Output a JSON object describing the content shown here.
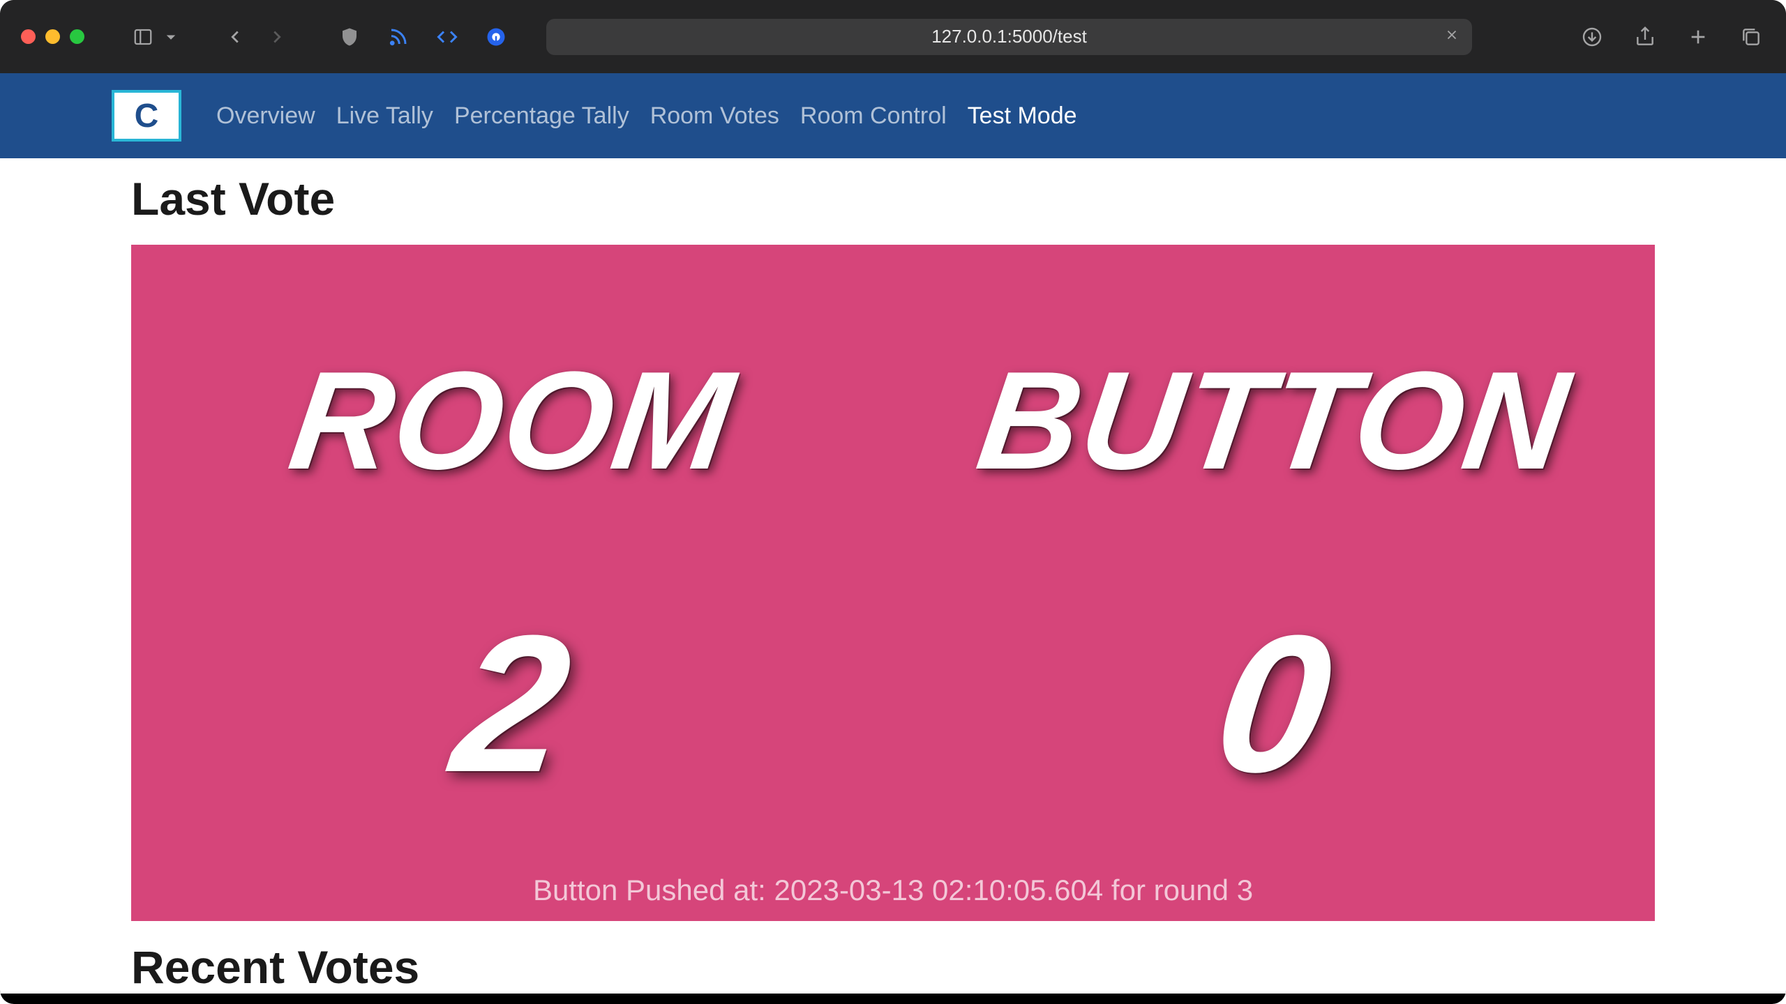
{
  "browser": {
    "url": "127.0.0.1:5000/test"
  },
  "nav": {
    "logo_letter": "C",
    "links": [
      {
        "label": "Overview",
        "active": false
      },
      {
        "label": "Live Tally",
        "active": false
      },
      {
        "label": "Percentage Tally",
        "active": false
      },
      {
        "label": "Room Votes",
        "active": false
      },
      {
        "label": "Room Control",
        "active": false
      },
      {
        "label": "Test Mode",
        "active": true
      }
    ]
  },
  "main": {
    "last_vote_title": "Last Vote",
    "recent_votes_title": "Recent Votes",
    "panel": {
      "room_label": "ROOM",
      "button_label": "BUTTON",
      "room_value": "2",
      "button_value": "0",
      "status": "Button Pushed at: 2023-03-13 02:10:05.604 for round 3",
      "bg_color": "#d6457a"
    }
  }
}
